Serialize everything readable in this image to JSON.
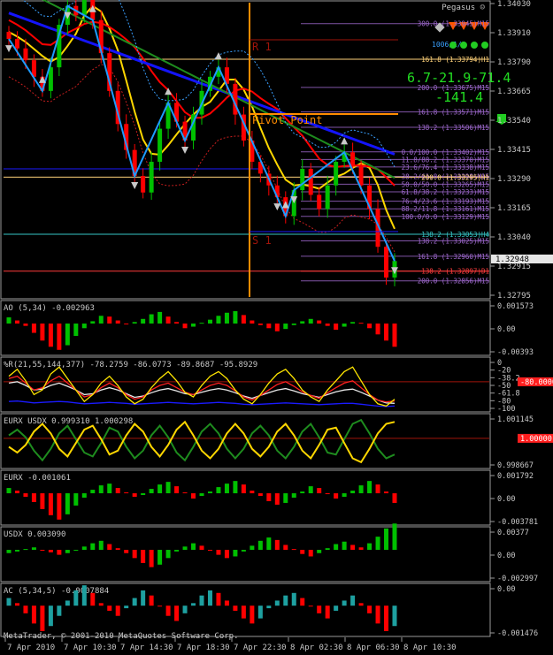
{
  "colors": {
    "background": "#000000",
    "frame": "#9a9a9a",
    "candle_up": "#00c000",
    "candle_down": "#ff0000",
    "wave": "#1e9bff",
    "ma_red": "#ff0000",
    "ma_yellow": "#ffd700",
    "ma_blue": "#1414ff",
    "ma_green": "#1e8c1e",
    "pivot": "#ff8c00",
    "fib_violet": "#a06ad0"
  },
  "main_panel": {
    "symbol_label": "Pegasus ☺",
    "price_axis": [
      "1.34030",
      "1.33910",
      "1.33790",
      "1.33665",
      "1.33540",
      "1.33415",
      "1.33290",
      "1.33165",
      "1.33040",
      "1.32915",
      "1.32795"
    ],
    "current_price": "1.32948",
    "level_labels": {
      "r1": "R 1",
      "pivot": "Pivot Point",
      "s1": "S 1"
    },
    "signal": {
      "line1": "6.7-21.9-71.4",
      "line2": "-141.4"
    },
    "fib_labels": [
      "300.0 (1.33945)M15",
      "161.8 (1.33794)H1",
      "200.0 (1.33675)M15",
      "161.8 (1.33571)M15",
      "138.2 (1.33506)M15",
      "0.0/100.0 (1.33402)M15",
      "11.8/88.2 (1.33370)M15",
      "23.6/76.4 (1.33338)M15",
      "38.2/61.8 (1.33298)M15",
      "200.0 (1.33295)H1",
      "50.0/50.0 (1.33265)M15",
      "61.8/38.2 (1.33233)M15",
      "76.4/23.6 (1.33193)M15",
      "88.2/11.8 (1.33161)M15",
      "100.0/0.0 (1.33129)M15",
      "138.2 (1.33053)H4",
      "138.2 (1.33025)M15",
      "161.8 (1.32960)M15",
      "138.2 (1.32897)D1",
      "200.0 (1.32856)M15"
    ],
    "side_label": "1006/1/1"
  },
  "panels": [
    {
      "title": "AO (5,34) -0.002963",
      "axis": [
        "0.001573",
        "0.00",
        "-0.00393"
      ]
    },
    {
      "title": "%R(21,55,144,377) -78.2759 -86.0773 -89.8687 -95.8929",
      "axis": [
        "0",
        "-20",
        "-38.2",
        "-50",
        "-61.8",
        "-80",
        "-100"
      ],
      "marker": "-80.0000"
    },
    {
      "title": "EURX USDX 0.999310 1.000298",
      "axis": [
        "1.001145",
        "0.998667"
      ],
      "marker": "1.00000"
    },
    {
      "title": "EURX -0.001061",
      "axis": [
        "0.001792",
        "0.00",
        "-0.003781"
      ]
    },
    {
      "title": "USDX 0.003090",
      "axis": [
        "0.00377",
        "0.00",
        "-0.002997"
      ]
    },
    {
      "title": "AC (5,34,5) -0.0007884",
      "axis": [
        "0.00",
        "-0.001476"
      ]
    }
  ],
  "time_axis": [
    "7 Apr 2010",
    "7 Apr 10:30",
    "7 Apr 14:30",
    "7 Apr 18:30",
    "7 Apr 22:30",
    "8 Apr 02:30",
    "8 Apr 06:30",
    "8 Apr 10:30"
  ],
  "copyright": "MetaTrader, © 2001-2010 MetaQuotes Software Corp.",
  "chart_data": {
    "type": "candlestick",
    "title": "Pegasus",
    "x": [
      "7 Apr 2010",
      "7 Apr 10:30",
      "7 Apr 14:30",
      "7 Apr 18:30",
      "7 Apr 22:30",
      "8 Apr 02:30",
      "8 Apr 06:30",
      "8 Apr 10:30"
    ],
    "ylim": [
      1.32795,
      1.3403
    ],
    "close_path": [
      1.3388,
      1.3384,
      1.3379,
      1.3372,
      1.3366,
      1.3376,
      1.3394,
      1.3402,
      1.3398,
      1.3405,
      1.3396,
      1.3382,
      1.3366,
      1.3352,
      1.3341,
      1.333,
      1.3323,
      1.3336,
      1.335,
      1.3361,
      1.3353,
      1.3345,
      1.3356,
      1.3366,
      1.3372,
      1.3376,
      1.3369,
      1.3356,
      1.3345,
      1.3336,
      1.3331,
      1.3326,
      1.3321,
      1.3313,
      1.3324,
      1.3333,
      1.3322,
      1.3316,
      1.3326,
      1.3336,
      1.334,
      1.3334,
      1.3326,
      1.3316,
      1.33,
      1.3287,
      1.3294
    ],
    "series": [
      {
        "name": "AO (5,34)",
        "last": -0.002963
      },
      {
        "name": "%R(21,55,144,377)",
        "last": [
          -78.2759,
          -86.0773,
          -89.8687,
          -95.8929
        ]
      },
      {
        "name": "EURX USDX",
        "last": [
          0.99931,
          1.000298
        ]
      },
      {
        "name": "EURX",
        "last": -0.001061
      },
      {
        "name": "USDX",
        "last": 0.00309
      },
      {
        "name": "AC (5,34,5)",
        "last": -0.0007884
      }
    ],
    "panel_data": {
      "ao": [
        0.0008,
        0.0004,
        -0.0003,
        -0.0012,
        -0.0022,
        -0.003,
        -0.0034,
        -0.0028,
        -0.0016,
        -0.0006,
        0.0003,
        0.001,
        0.0009,
        0.0004,
        -0.0001,
        0.0002,
        0.0006,
        0.0012,
        0.0015,
        0.0009,
        0.0002,
        -0.0006,
        -0.0004,
        0.0001,
        0.0005,
        0.001,
        0.0014,
        0.0016,
        0.0011,
        0.0004,
        -0.0002,
        -0.0006,
        -0.001,
        -0.0007,
        -0.0002,
        0.0003,
        0.0006,
        0.0004,
        -0.0003,
        -0.0008,
        -0.0004,
        0.0002,
        0.0001,
        -0.0006,
        -0.0014,
        -0.0022,
        -0.003
      ],
      "eurx": [
        0.0006,
        0.0003,
        -0.0004,
        -0.001,
        -0.0018,
        -0.0025,
        -0.003,
        -0.0024,
        -0.0014,
        -0.0005,
        0.0004,
        0.0009,
        0.0011,
        0.0006,
        0.0001,
        -0.0004,
        -0.0002,
        0.0005,
        0.001,
        0.0013,
        0.0008,
        0.0001,
        -0.0006,
        -0.0003,
        0.0002,
        0.0007,
        0.0011,
        0.0014,
        0.001,
        0.0003,
        -0.0003,
        -0.0009,
        -0.0013,
        -0.0011,
        -0.0005,
        0.0002,
        0.0008,
        0.0006,
        0.0,
        -0.0006,
        -0.0004,
        0.0003,
        0.0009,
        0.0014,
        0.001,
        0.0002,
        -0.0011
      ],
      "usdx": [
        -0.0004,
        -0.0002,
        0.0001,
        0.0003,
        0.0,
        -0.0003,
        -0.0006,
        -0.0004,
        0.0,
        0.0004,
        0.0008,
        0.0011,
        0.0007,
        0.0002,
        -0.0004,
        -0.001,
        -0.0016,
        -0.0021,
        -0.0018,
        -0.001,
        -0.0002,
        0.0004,
        0.0008,
        0.0005,
        0.0,
        -0.0006,
        -0.001,
        -0.0008,
        -0.0002,
        0.0005,
        0.0011,
        0.0015,
        0.0012,
        0.0006,
        0.0001,
        -0.0005,
        -0.0008,
        -0.0004,
        0.0002,
        0.0007,
        0.001,
        0.0006,
        0.0003,
        0.0008,
        0.0016,
        0.0026,
        0.0032
      ],
      "ac": [
        0.0003,
        0.0001,
        -0.0003,
        -0.0007,
        -0.001,
        -0.0008,
        -0.0004,
        0.0002,
        0.0006,
        0.0008,
        0.0005,
        0.0001,
        -0.0002,
        -0.0004,
        -0.0001,
        0.0003,
        0.0006,
        0.0004,
        0.0,
        -0.0004,
        -0.0006,
        -0.0003,
        0.0001,
        0.0004,
        0.0006,
        0.0005,
        0.0002,
        -0.0002,
        -0.0005,
        -0.0007,
        -0.0005,
        -0.0001,
        0.0002,
        0.0004,
        0.0005,
        0.0003,
        0.0,
        -0.0003,
        -0.0005,
        -0.0002,
        0.0002,
        0.0004,
        0.0001,
        -0.0003,
        -0.0007,
        -0.001,
        -0.0008
      ],
      "willr_yellow": [
        -30,
        -15,
        -40,
        -70,
        -60,
        -25,
        -10,
        -35,
        -60,
        -85,
        -70,
        -45,
        -30,
        -50,
        -75,
        -90,
        -80,
        -55,
        -35,
        -20,
        -40,
        -65,
        -75,
        -50,
        -30,
        -20,
        -35,
        -60,
        -80,
        -90,
        -70,
        -45,
        -25,
        -15,
        -35,
        -60,
        -75,
        -85,
        -60,
        -40,
        -20,
        -10,
        -40,
        -70,
        -90,
        -95,
        -80
      ],
      "willr_red": [
        -35,
        -30,
        -45,
        -60,
        -55,
        -40,
        -30,
        -45,
        -60,
        -75,
        -70,
        -55,
        -45,
        -55,
        -70,
        -80,
        -75,
        -60,
        -50,
        -45,
        -55,
        -65,
        -70,
        -60,
        -50,
        -45,
        -50,
        -62,
        -75,
        -82,
        -72,
        -60,
        -48,
        -42,
        -52,
        -64,
        -72,
        -78,
        -66,
        -55,
        -45,
        -40,
        -55,
        -70,
        -82,
        -86,
        -84
      ],
      "willr_white": [
        -45,
        -42,
        -50,
        -60,
        -58,
        -50,
        -45,
        -52,
        -60,
        -70,
        -68,
        -60,
        -55,
        -60,
        -68,
        -76,
        -73,
        -66,
        -60,
        -57,
        -62,
        -68,
        -70,
        -65,
        -60,
        -57,
        -60,
        -66,
        -73,
        -78,
        -72,
        -66,
        -60,
        -57,
        -62,
        -68,
        -72,
        -76,
        -70,
        -64,
        -60,
        -58,
        -65,
        -73,
        -82,
        -88,
        -89
      ],
      "willr_blue": [
        -85,
        -84,
        -86,
        -88,
        -87,
        -86,
        -85,
        -86,
        -88,
        -90,
        -89,
        -88,
        -87,
        -88,
        -89,
        -91,
        -90,
        -89,
        -88,
        -87,
        -88,
        -89,
        -90,
        -89,
        -88,
        -87,
        -88,
        -89,
        -91,
        -92,
        -91,
        -90,
        -89,
        -88,
        -89,
        -90,
        -91,
        -92,
        -91,
        -90,
        -89,
        -89,
        -91,
        -93,
        -95,
        -96,
        -95
      ],
      "eurx_line": [
        1.0003,
        1.0006,
        1.0002,
        0.9995,
        0.999,
        0.9996,
        1.0004,
        1.0008,
        1.0001,
        0.9994,
        0.9992,
        0.9999,
        1.0007,
        1.0005,
        0.9997,
        0.9991,
        0.9995,
        1.0003,
        1.0008,
        1.0002,
        0.9994,
        0.999,
        0.9997,
        1.0005,
        1.0009,
        1.0004,
        0.9996,
        0.9991,
        0.9996,
        1.0004,
        1.0008,
        1.0003,
        0.9995,
        0.9991,
        0.9997,
        1.0005,
        1.0009,
        1.0002,
        0.9994,
        0.9993,
        1.0001,
        1.0009,
        1.0011,
        1.0004,
        0.9996,
        0.9991,
        0.9993
      ],
      "usdx_line": [
        0.9997,
        0.9994,
        0.9998,
        1.0005,
        1.0009,
        1.0004,
        0.9996,
        0.9992,
        0.9999,
        1.0006,
        1.0008,
        1.0001,
        0.9993,
        0.9995,
        1.0003,
        1.0009,
        1.0005,
        0.9997,
        0.9992,
        0.9998,
        1.0006,
        1.001,
        1.0003,
        0.9995,
        0.9991,
        0.9996,
        1.0004,
        1.0009,
        1.0004,
        0.9996,
        0.9992,
        0.9997,
        1.0005,
        1.0009,
        1.0003,
        0.9995,
        0.9991,
        0.9998,
        1.0006,
        1.0007,
        0.9999,
        0.9991,
        0.9989,
        0.9996,
        1.0004,
        1.0009,
        1.001
      ]
    }
  }
}
